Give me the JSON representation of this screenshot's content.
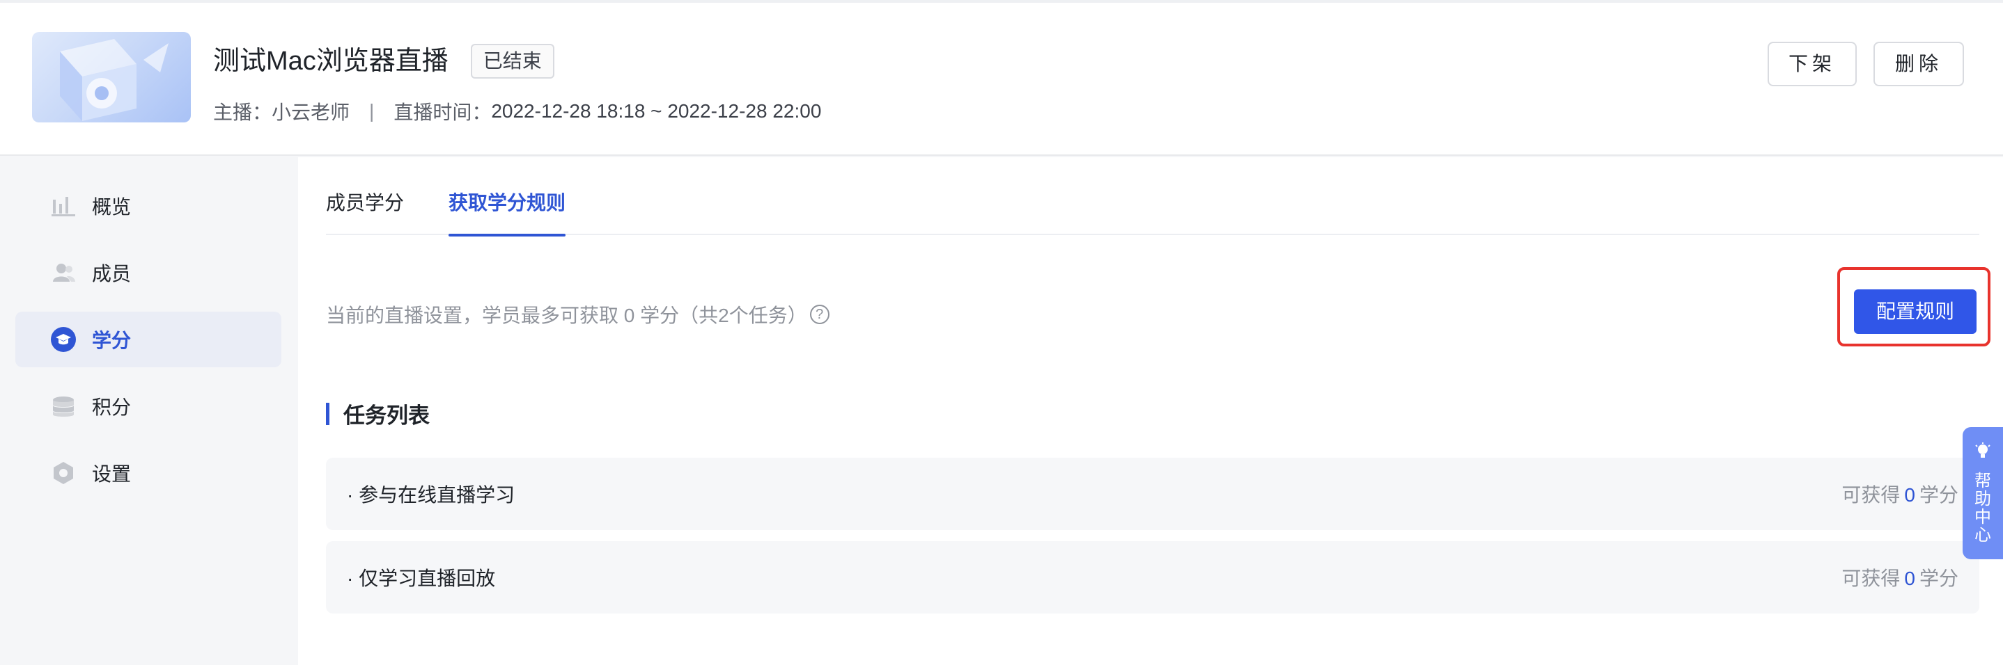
{
  "header": {
    "title": "测试Mac浏览器直播",
    "status_badge": "已结束",
    "host_label": "主播：",
    "host_name": "小云老师",
    "separator": "|",
    "time_label": "直播时间：",
    "time_value": "2022-12-28 18:18 ~ 2022-12-28 22:00",
    "unpublish_label": "下架",
    "delete_label": "删除"
  },
  "sidebar": {
    "items": [
      {
        "label": "概览",
        "icon": "bar-chart-icon"
      },
      {
        "label": "成员",
        "icon": "users-icon"
      },
      {
        "label": "学分",
        "icon": "graduation-cap-icon",
        "active": true
      },
      {
        "label": "积分",
        "icon": "coin-stack-icon"
      },
      {
        "label": "设置",
        "icon": "gear-icon"
      }
    ]
  },
  "tabs": [
    {
      "label": "成员学分"
    },
    {
      "label": "获取学分规则",
      "active": true
    }
  ],
  "summary": {
    "text": "当前的直播设置，学员最多可获取 0 学分（共2个任务）",
    "help_glyph": "?"
  },
  "config_button": "配置规则",
  "task_section": {
    "title": "任务列表",
    "tasks": [
      {
        "name": "· 参与在线直播学习",
        "reward_prefix": "可获得",
        "reward_value": "0",
        "reward_unit": "学分"
      },
      {
        "name": "· 仅学习直播回放",
        "reward_prefix": "可获得",
        "reward_value": "0",
        "reward_unit": "学分"
      }
    ]
  },
  "help_center": {
    "label": "帮助中心",
    "icon": "lightbulb-icon"
  },
  "colors": {
    "accent": "#2f55d4",
    "button": "#3056e8",
    "highlight": "#e8332d"
  }
}
